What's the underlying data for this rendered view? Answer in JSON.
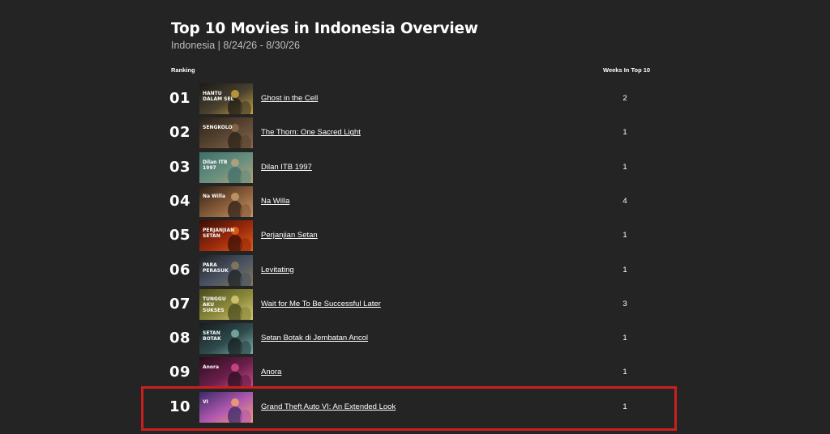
{
  "header": {
    "title": "Top 10 Movies in Indonesia Overview",
    "subtitle": "Indonesia | 8/24/26 - 8/30/26"
  },
  "columns": {
    "ranking": "Ranking",
    "weeks": "Weeks In Top 10"
  },
  "rows": [
    {
      "rank": "01",
      "title": "Ghost in the Cell",
      "weeks": "2",
      "thumb_text": "HANTU DALAM SEL",
      "thumb_colors": [
        "#1b1a14",
        "#4a4130",
        "#c9a53a"
      ]
    },
    {
      "rank": "02",
      "title": "The Thorn: One Sacred Light",
      "weeks": "1",
      "thumb_text": "SENGKOLO",
      "thumb_colors": [
        "#2a2218",
        "#5a4632",
        "#8a6a4a"
      ]
    },
    {
      "rank": "03",
      "title": "Dilan ITB 1997",
      "weeks": "1",
      "thumb_text": "Dilan ITB 1997",
      "thumb_colors": [
        "#3d6f6a",
        "#6a8f7e",
        "#b9a27c"
      ]
    },
    {
      "rank": "04",
      "title": "Na Willa",
      "weeks": "4",
      "thumb_text": "Na Willa",
      "thumb_colors": [
        "#2d2016",
        "#8a5d3a",
        "#c79a70"
      ]
    },
    {
      "rank": "05",
      "title": "Perjanjian Setan",
      "weeks": "1",
      "thumb_text": "PERJANJIAN SETAN",
      "thumb_colors": [
        "#3a0e06",
        "#9c2a0c",
        "#e0641a"
      ]
    },
    {
      "rank": "06",
      "title": "Levitating",
      "weeks": "1",
      "thumb_text": "PARA PERASUK",
      "thumb_colors": [
        "#1e2126",
        "#4b5563",
        "#8a7a5a"
      ]
    },
    {
      "rank": "07",
      "title": "Wait for Me To Be Successful Later",
      "weeks": "3",
      "thumb_text": "TUNGGU AKU SUKSES NANTI",
      "thumb_colors": [
        "#4a4a1e",
        "#8c8a3a",
        "#d8c97a"
      ]
    },
    {
      "rank": "08",
      "title": "Setan Botak di Jembatan Ancol",
      "weeks": "1",
      "thumb_text": "SETAN BOTAK",
      "thumb_colors": [
        "#141c1e",
        "#2f4a4c",
        "#7fb0a8"
      ]
    },
    {
      "rank": "09",
      "title": "Anora",
      "weeks": "1",
      "thumb_text": "Anora",
      "thumb_colors": [
        "#2a0d1e",
        "#6a1f4a",
        "#d24a8a"
      ]
    },
    {
      "rank": "10",
      "title": "Grand Theft Auto VI: An Extended Look",
      "weeks": "1",
      "thumb_text": "VI",
      "thumb_colors": [
        "#3a2a6a",
        "#b45ab0",
        "#f3a26a"
      ]
    }
  ],
  "highlight": {
    "color": "#c9201f",
    "target_rank": "10"
  }
}
